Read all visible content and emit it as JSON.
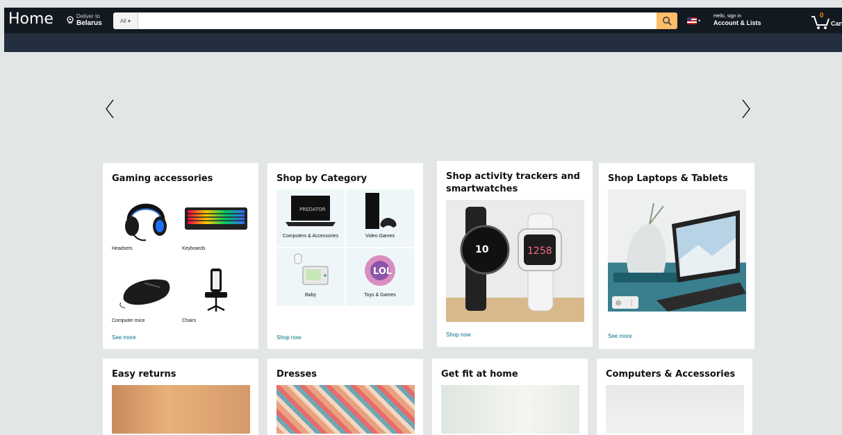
{
  "header": {
    "logo": "Home",
    "deliver_small": "Deliver to",
    "deliver_big": "Belarus",
    "search_category": "All",
    "search_placeholder": "",
    "flag_caret": "▾",
    "account_small": "Hello, sign in",
    "account_big": "Account & Lists",
    "cart_count": "0",
    "cart_label": "Cart"
  },
  "icons": {
    "search": "search-icon",
    "location": "location-pin-icon",
    "cart": "cart-icon",
    "prev": "chevron-left-icon",
    "next": "chevron-right-icon"
  },
  "colors": {
    "nav": "#131921",
    "subnav": "#232f3e",
    "search_button": "#febd69",
    "link": "#007185",
    "cart_count": "#f08804"
  },
  "cards": {
    "gaming": {
      "title": "Gaming accessories",
      "items": [
        "Headsets",
        "Keyboards",
        "Computer mice",
        "Chairs"
      ],
      "link": "See more"
    },
    "category": {
      "title": "Shop by Category",
      "items": [
        "Computers & Accessories",
        "Video Games",
        "Baby",
        "Toys & Games"
      ],
      "link": "Shop now"
    },
    "trackers": {
      "title": "Shop activity trackers and smartwatches",
      "watch_left": "10",
      "watch_right": "1258",
      "link": "Shop now"
    },
    "laptops": {
      "title": "Shop Laptops & Tablets",
      "link": "See more"
    },
    "returns": {
      "title": "Easy returns"
    },
    "dresses": {
      "title": "Dresses"
    },
    "fit": {
      "title": "Get fit at home"
    },
    "computers": {
      "title": "Computers & Accessories"
    }
  }
}
